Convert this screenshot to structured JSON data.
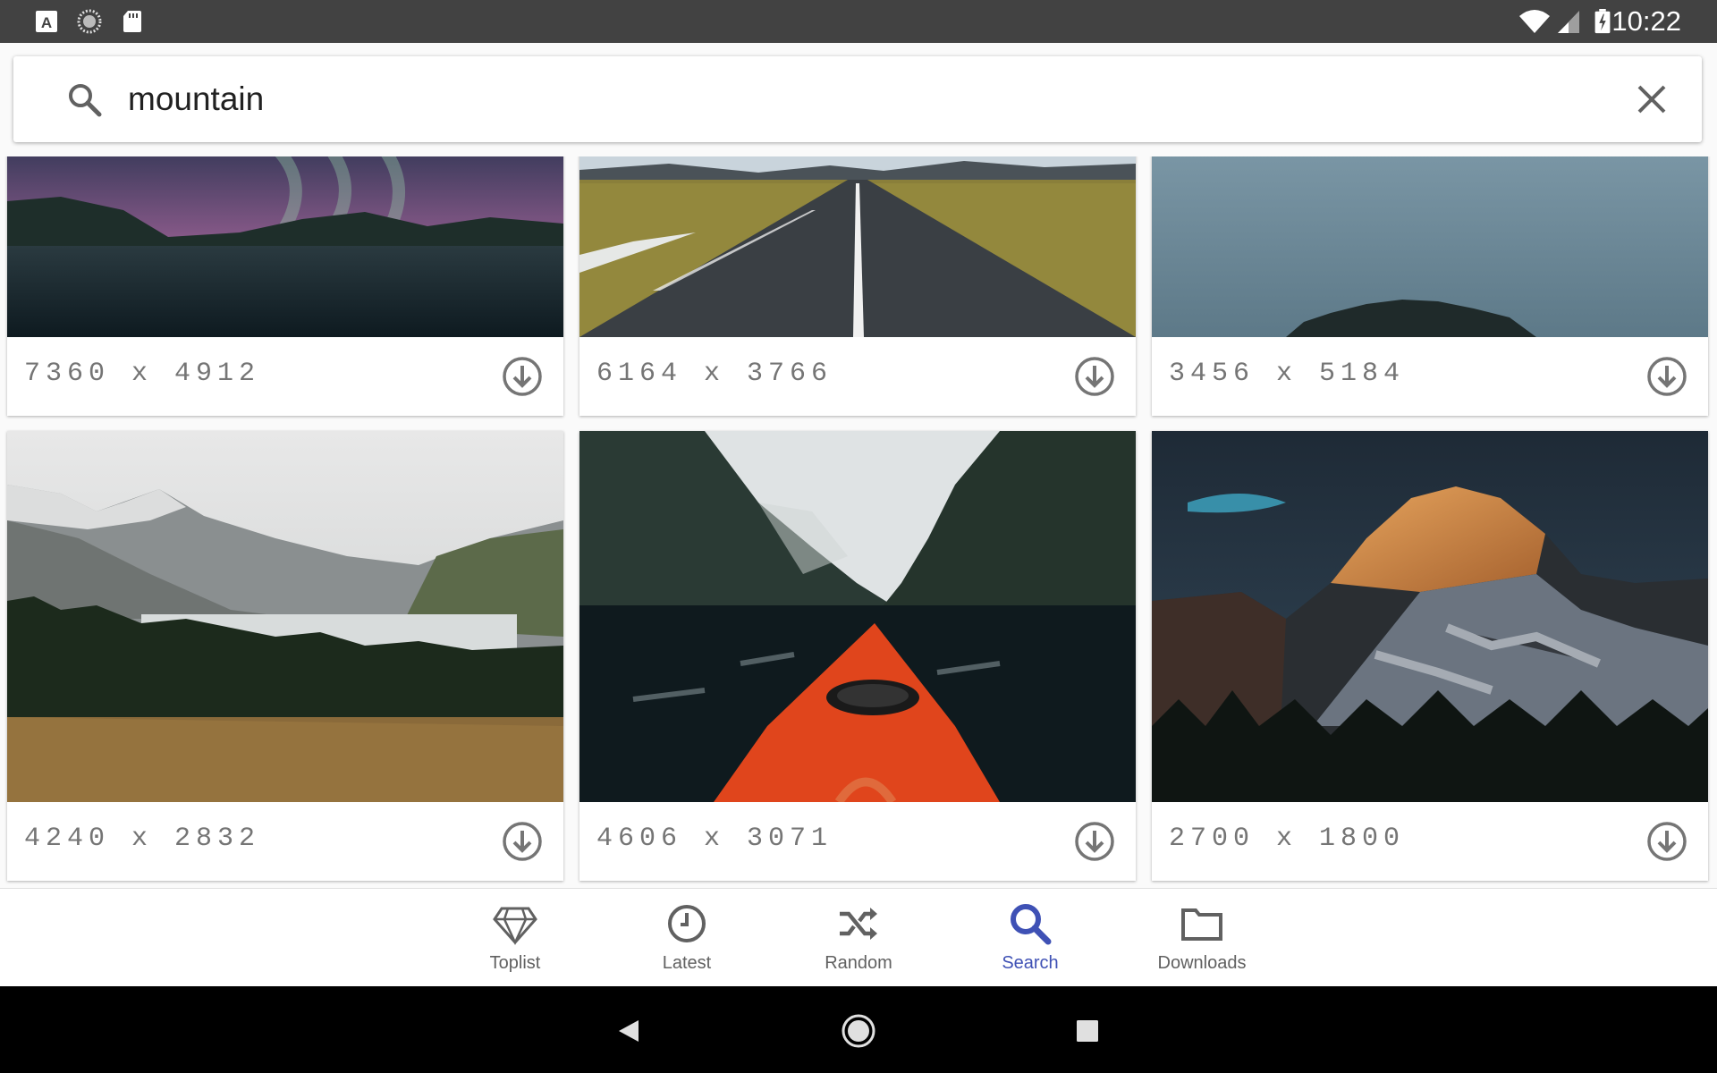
{
  "status_bar": {
    "time": "10:22",
    "left_icons": [
      "app-a-icon",
      "loading-icon",
      "sd-card-icon"
    ],
    "right_icons": [
      "wifi-icon",
      "signal-icon",
      "battery-icon"
    ]
  },
  "search": {
    "query": "mountain",
    "placeholder": ""
  },
  "wallpapers": [
    {
      "resolution": "7360 x 4912"
    },
    {
      "resolution": "6164 x 3766"
    },
    {
      "resolution": "3456 x 5184"
    },
    {
      "resolution": "4240 x 2832"
    },
    {
      "resolution": "4606 x 3071"
    },
    {
      "resolution": "2700 x 1800"
    }
  ],
  "bottom_nav": {
    "items": [
      {
        "label": "Toplist",
        "icon": "diamond-icon"
      },
      {
        "label": "Latest",
        "icon": "clock-icon"
      },
      {
        "label": "Random",
        "icon": "shuffle-icon"
      },
      {
        "label": "Search",
        "icon": "search-icon"
      },
      {
        "label": "Downloads",
        "icon": "folder-icon"
      }
    ],
    "active": "Search"
  },
  "colors": {
    "accent": "#3f51b5",
    "status_bar": "#424242",
    "nav_inactive": "#616161"
  }
}
